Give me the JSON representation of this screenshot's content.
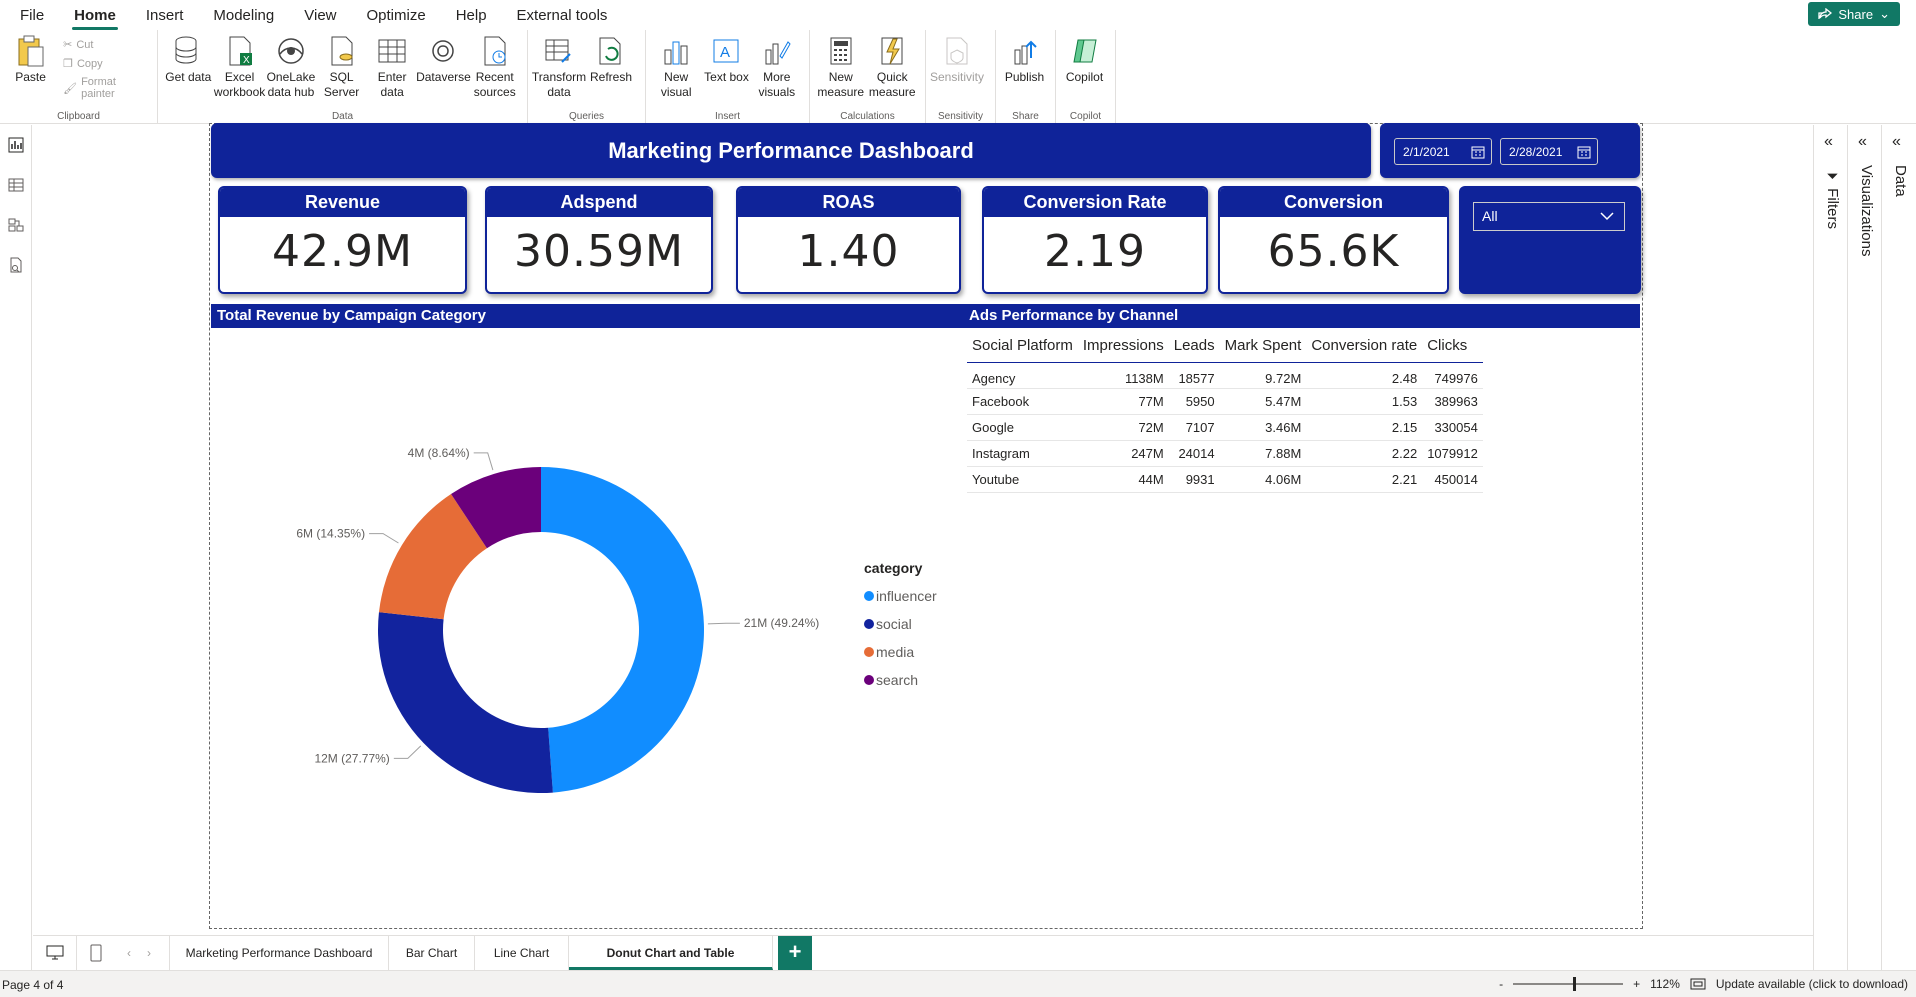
{
  "menu": {
    "items": [
      "File",
      "Home",
      "Insert",
      "Modeling",
      "View",
      "Optimize",
      "Help",
      "External tools"
    ],
    "active": "Home",
    "share_label": "Share"
  },
  "ribbon": {
    "clipboard": {
      "title": "Clipboard",
      "paste": "Paste",
      "cut": "Cut",
      "copy": "Copy",
      "format_painter": "Format painter"
    },
    "data": {
      "title": "Data",
      "get_data": "Get data",
      "excel": "Excel workbook",
      "onelake": "OneLake data hub",
      "sql": "SQL Server",
      "enter": "Enter data",
      "dataverse": "Dataverse",
      "recent": "Recent sources"
    },
    "queries": {
      "title": "Queries",
      "transform": "Transform data",
      "refresh": "Refresh"
    },
    "insert": {
      "title": "Insert",
      "new_visual": "New visual",
      "text_box": "Text box",
      "more_visuals": "More visuals"
    },
    "calculations": {
      "title": "Calculations",
      "new_measure": "New measure",
      "quick_measure": "Quick measure"
    },
    "sensitivity": {
      "title": "Sensitivity",
      "sensitivity": "Sensitivity"
    },
    "share": {
      "title": "Share",
      "publish": "Publish"
    },
    "copilot": {
      "title": "Copilot",
      "copilot": "Copilot"
    }
  },
  "report": {
    "title": "Marketing Performance Dashboard",
    "date_start": "2/1/2021",
    "date_end": "2/28/2021",
    "slicer_value": "All",
    "kpis": [
      {
        "label": "Revenue",
        "value": "42.9M"
      },
      {
        "label": "Adspend",
        "value": "30.59M"
      },
      {
        "label": "ROAS",
        "value": "1.40"
      },
      {
        "label": "Conversion Rate",
        "value": "2.19"
      },
      {
        "label": "Conversion",
        "value": "65.6K"
      }
    ],
    "donut_section_title": "Total Revenue by Campaign Category",
    "table_section_title": "Ads Performance by Channel"
  },
  "chart_data": {
    "type": "pie",
    "title": "Total Revenue by Campaign Category",
    "legend_title": "category",
    "legend_position": "right",
    "categories": [
      "influencer",
      "social",
      "media",
      "search"
    ],
    "values": [
      21,
      12,
      6,
      4
    ],
    "percentages": [
      49.24,
      27.77,
      14.35,
      8.64
    ],
    "data_labels": [
      "21M (49.24%)",
      "12M (27.77%)",
      "6M (14.35%)",
      "4M (8.64%)"
    ],
    "colors": [
      "#118dff",
      "#12239e",
      "#e66c37",
      "#6b007b"
    ]
  },
  "table": {
    "columns": [
      "Social Platform",
      "Impressions",
      "Leads",
      "Mark Spent",
      "Conversion rate",
      "Clicks"
    ],
    "rows": [
      [
        "Agency",
        "1138M",
        "18577",
        "9.72M",
        "2.48",
        "749976"
      ],
      [
        "Facebook",
        "77M",
        "5950",
        "5.47M",
        "1.53",
        "389963"
      ],
      [
        "Google",
        "72M",
        "7107",
        "3.46M",
        "2.15",
        "330054"
      ],
      [
        "Instagram",
        "247M",
        "24014",
        "7.88M",
        "2.22",
        "1079912"
      ],
      [
        "Youtube",
        "44M",
        "9931",
        "4.06M",
        "2.21",
        "450014"
      ]
    ]
  },
  "panes": {
    "filters": "Filters",
    "visualizations": "Visualizations",
    "data": "Data"
  },
  "pages": {
    "tabs": [
      "Marketing Performance Dashboard",
      "Bar Chart",
      "Line Chart",
      "Donut Chart and Table"
    ],
    "active": "Donut Chart and Table",
    "add_label": "+"
  },
  "status": {
    "page": "Page 4 of 4",
    "zoom": "112%",
    "update": "Update available (click to download)"
  },
  "colors": {
    "navy": "#0f2399",
    "accent": "#117865"
  }
}
